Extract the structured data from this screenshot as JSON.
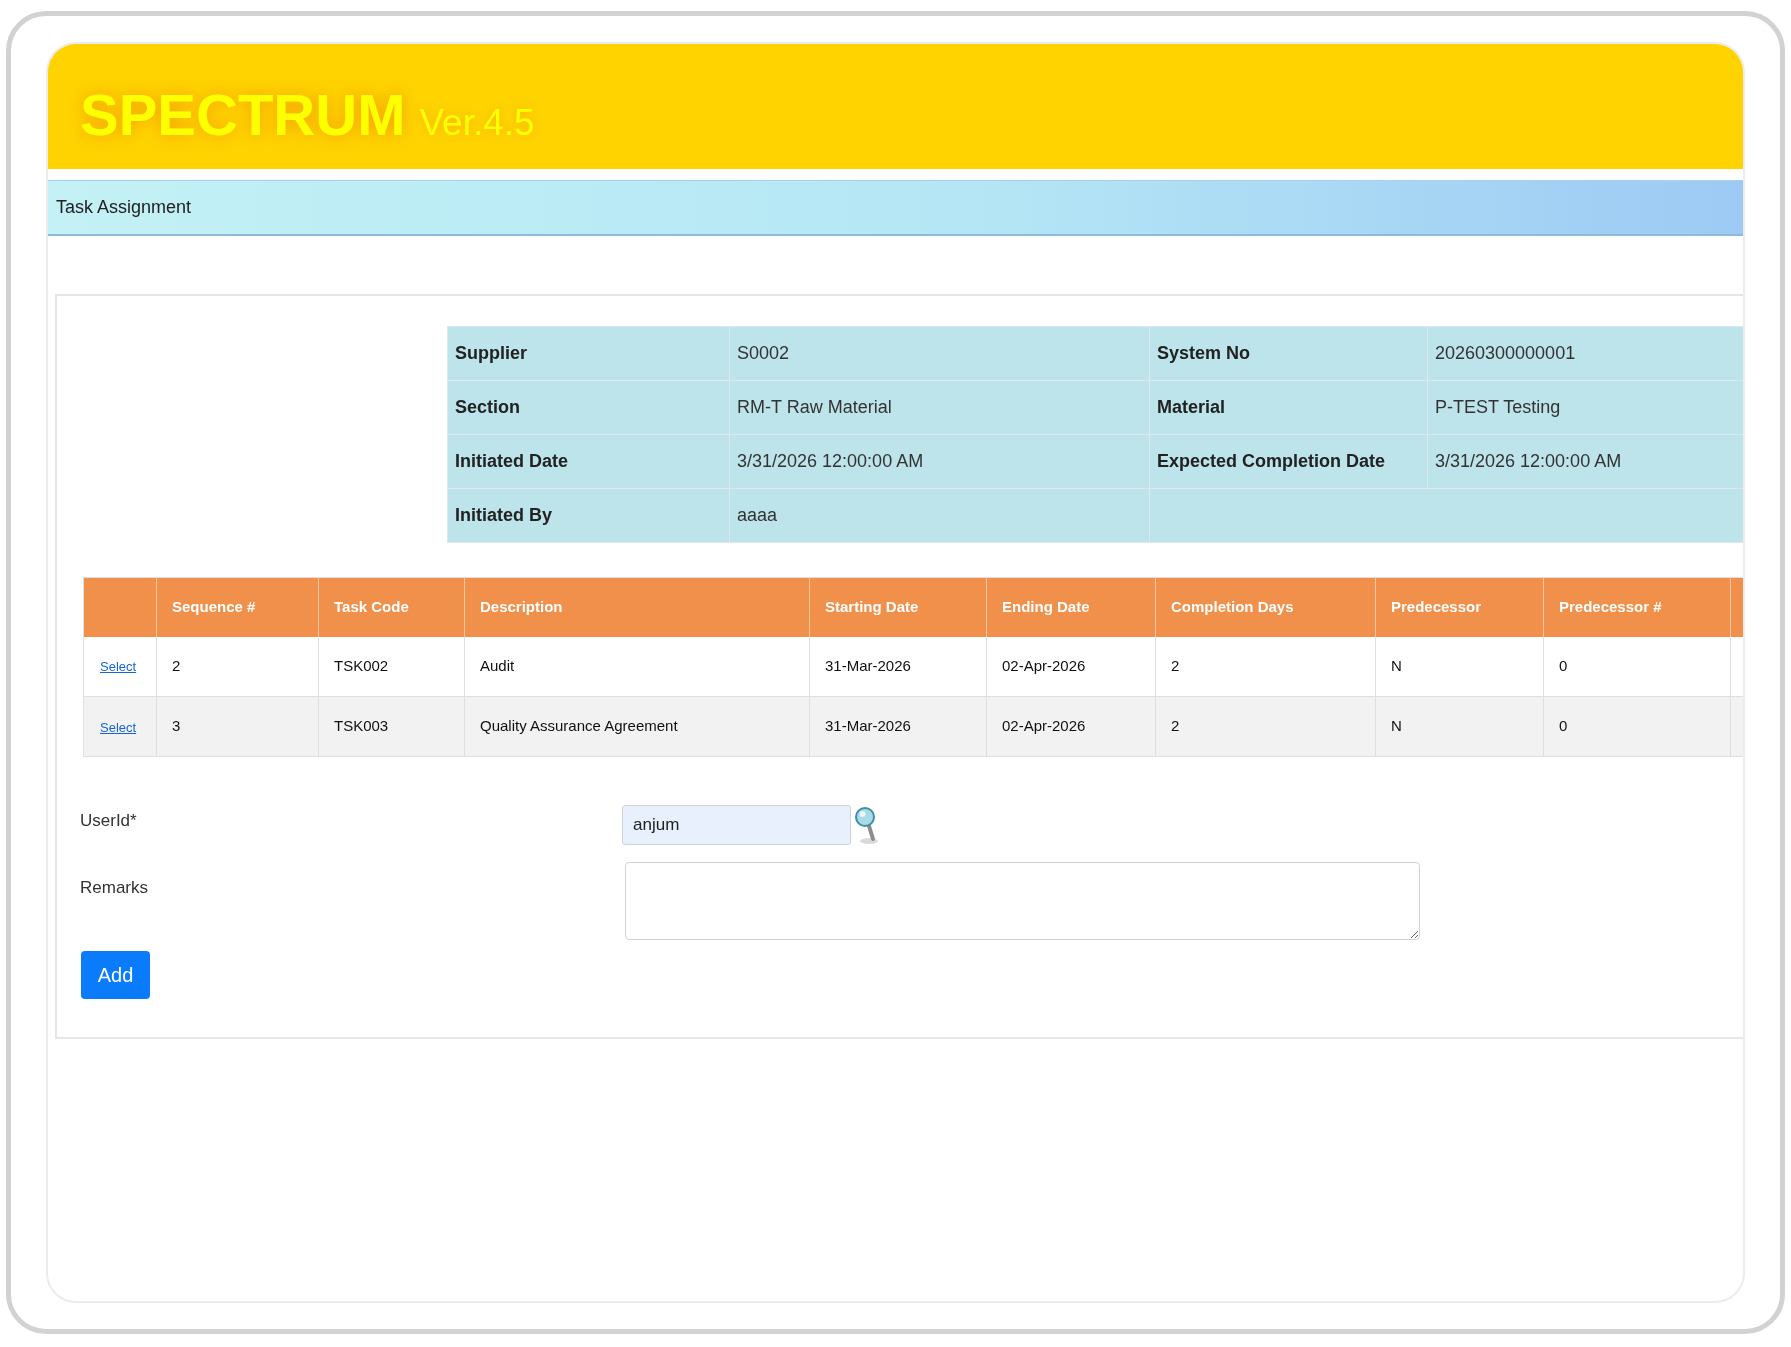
{
  "header": {
    "title": "SPECTRUM",
    "version": "Ver.4.5"
  },
  "title_bar": {
    "title": "Task Assignment"
  },
  "details": {
    "rows": [
      [
        {
          "label": "Supplier",
          "value": "S0002"
        },
        {
          "label": "System No",
          "value": "20260300000001"
        }
      ],
      [
        {
          "label": "Section",
          "value": "RM-T Raw Material"
        },
        {
          "label": "Material",
          "value": "P-TEST Testing"
        }
      ],
      [
        {
          "label": "Initiated Date",
          "value": "3/31/2026 12:00:00 AM"
        },
        {
          "label": "Expected Completion Date",
          "value": "3/31/2026 12:00:00 AM"
        }
      ],
      [
        {
          "label": "Initiated By",
          "value": "aaaa"
        }
      ]
    ]
  },
  "tasks": {
    "columns": [
      "Sequence #",
      "Task Code",
      "Description",
      "Starting Date",
      "Ending Date",
      "Completion Days",
      "Predecessor",
      "Predecessor #"
    ],
    "rows": [
      {
        "link": "Select",
        "cells": [
          "2",
          "TSK002",
          "Audit",
          "31-Mar-2026",
          "02-Apr-2026",
          "2",
          "N",
          "0"
        ]
      },
      {
        "link": "Select",
        "cells": [
          "3",
          "TSK003",
          "Quality Assurance Agreement",
          "31-Mar-2026",
          "02-Apr-2026",
          "2",
          "N",
          "0"
        ]
      }
    ]
  },
  "form": {
    "fields": [
      {
        "kind": "lookup",
        "label": "UserId*",
        "value": "anjum"
      },
      {
        "kind": "textarea",
        "label": "Remarks"
      }
    ],
    "button": "Add"
  }
}
